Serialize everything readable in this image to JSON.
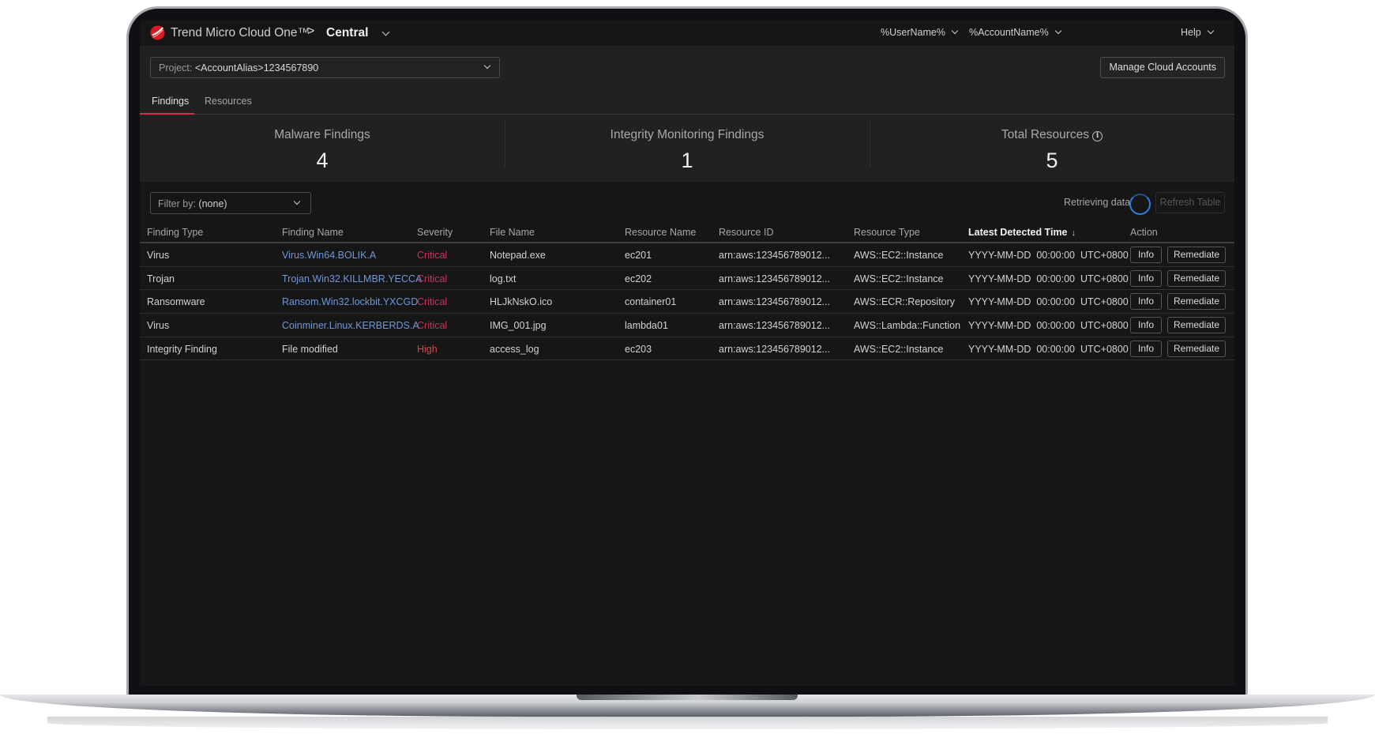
{
  "header": {
    "brand": "Trend Micro Cloud One™",
    "breadcrumb_separator": ">",
    "current_app": "Central",
    "user_menu": "%UserName%",
    "account_menu": "%AccountName%",
    "help_menu": "Help"
  },
  "project": {
    "label": "Project:",
    "value": "<AccountAlias>1234567890"
  },
  "manage_cloud_accounts": "Manage Cloud Accounts",
  "tabs": [
    {
      "label": "Findings",
      "active": true
    },
    {
      "label": "Resources",
      "active": false
    }
  ],
  "stats": [
    {
      "label": "Malware Findings",
      "value": "4"
    },
    {
      "label": "Integrity Monitoring Findings",
      "value": "1"
    },
    {
      "label": "Total Resources",
      "value": "5",
      "icon": "info-icon"
    }
  ],
  "filter": {
    "label": "Filter by:",
    "value": "(none)"
  },
  "status": {
    "retrieving": "Retrieving data",
    "refresh_label": "Refresh Table"
  },
  "table": {
    "columns": [
      "Finding Type",
      "Finding Name",
      "Severity",
      "File Name",
      "Resource Name",
      "Resource ID",
      "Resource Type",
      "Latest Detected Time",
      "Action"
    ],
    "sort_indicator": "↓",
    "actions": {
      "info": "Info",
      "remediate": "Remediate"
    },
    "rows": [
      {
        "type": "Virus",
        "name": "Virus.Win64.BOLIK.A",
        "severity": "Critical",
        "file": "Notepad.exe",
        "resource": "ec201",
        "resource_id": "arn:aws:123456789012...",
        "resource_type": "AWS::EC2::Instance",
        "time": "YYYY-MM-DD  00:00:00  UTC+0800",
        "link": true
      },
      {
        "type": "Trojan",
        "name": "Trojan.Win32.KILLMBR.YECCA",
        "severity": "Critical",
        "file": "log.txt",
        "resource": "ec202",
        "resource_id": "arn:aws:123456789012...",
        "resource_type": "AWS::EC2::Instance",
        "time": "YYYY-MM-DD  00:00:00  UTC+0800",
        "link": true
      },
      {
        "type": "Ransomware",
        "name": "Ransom.Win32.lockbit.YXCGD",
        "severity": "Critical",
        "file": "HLJkNskO.ico",
        "resource": "container01",
        "resource_id": "arn:aws:123456789012...",
        "resource_type": "AWS::ECR::Repository",
        "time": "YYYY-MM-DD  00:00:00  UTC+0800",
        "link": true
      },
      {
        "type": "Virus",
        "name": "Coinminer.Linux.KERBERDS.A",
        "severity": "Critical",
        "file": "IMG_001.jpg",
        "resource": "lambda01",
        "resource_id": "arn:aws:123456789012...",
        "resource_type": "AWS::Lambda::Function",
        "time": "YYYY-MM-DD  00:00:00  UTC+0800",
        "link": true
      },
      {
        "type": "Integrity Finding",
        "name": "File modified",
        "severity": "High",
        "file": "access_log",
        "resource": "ec203",
        "resource_id": "arn:aws:123456789012...",
        "resource_type": "AWS::EC2::Instance",
        "time": "YYYY-MM-DD  00:00:00  UTC+0800",
        "link": false
      }
    ]
  },
  "colors": {
    "accent_red": "#d32f3f",
    "critical": "#c8345a",
    "high": "#d8414e",
    "link": "#6f97da",
    "spinner": "#2f7de1"
  }
}
